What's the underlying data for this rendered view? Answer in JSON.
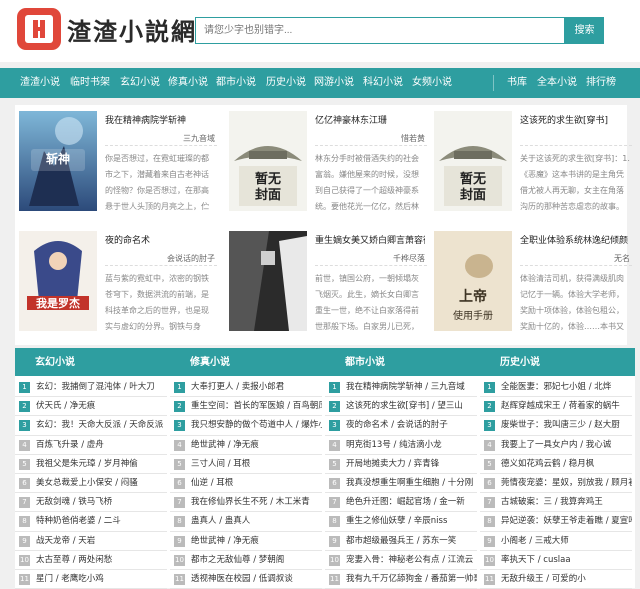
{
  "site": {
    "name": "渣渣小説網",
    "logo_letter": "H",
    "brand_color": "#e0473a",
    "accent_color": "#2e9ea0"
  },
  "search": {
    "placeholder": "请您少字也别错字...",
    "button": "搜索"
  },
  "nav": {
    "items": [
      "渣渣小说",
      "临时书架",
      "玄幻小说",
      "修真小说",
      "都市小说",
      "历史小说",
      "网游小说",
      "科幻小说",
      "女频小说"
    ],
    "right_items": [
      "书库",
      "全本小说",
      "排行榜"
    ]
  },
  "featured": [
    {
      "title": "我在精神病院学斩神",
      "author": "三九音域",
      "desc": "你是否想过，在霓虹璀璨的都市之下，潜藏着来自古老神话的怪物？你是否想过，在那高悬于世人头顶的月亮之上，伫立着守望人间的神明？你是否想过，在",
      "cover": "book1"
    },
    {
      "title": "亿亿神豪林东江珊",
      "author": "惜若黄",
      "desc": "林东分手时被借酒失约的社会富翁。嫌他屋来的时候，没想到自己获得了一个超级神豪系统。要他花光一亿亿，然后林东从此走上人生巅峰。林东：我不就了，我是",
      "cover": "placeholder"
    },
    {
      "title": "这该死的求生欲[穿书]",
      "author": "",
      "desc": "关于这该死的求生欲[穿书]：1.《恶魔》这本书讲的是主角凭借尤被人再无聊，女主在角落沟历的那种苦恋虐恋的故事。江落一穿醒来，穿成了这本书里拿一",
      "cover": "placeholder"
    },
    {
      "title": "夜的命名术",
      "author": "会说话的肘子",
      "desc": "蓝与紫的霓虹中，浓密的钢铁苍穹下，数据洪流的前端，是科技革命之后的世界，也是现实与虚幻的分界。钢铁与身体，过去与未来。这里，表世界与里世界",
      "cover": "book4"
    },
    {
      "title": "重生嫡女美又娇白卿言萧容衍",
      "author": "千桦尽落",
      "desc": "前世，镇国公府，一朝倾塌灰飞烟灭。此生，嫡长女白卿言重生一世，绝不让白家落得前世那般下场。白家男儿已死，大都城再无白家立锥之地？",
      "cover": "book5"
    },
    {
      "title": "全职业体验系统林逸纪倾颜",
      "author": "无名",
      "desc": "体验清洁司机，获得满级肌肉记忆于一辆。体验大学老师，奖励十项体验，体验包租公，奖励十亿的，体验……本书又名：《香烟宿舍》我的十个身份 …《都市未",
      "cover": "book6"
    }
  ],
  "lists": [
    {
      "title": "玄幻小说",
      "items": [
        "玄幻：我捕倒了混沌体 / 叶大刀",
        "伏天氏 / 净无痕",
        "玄幻：我！天命大反派 / 天命反派",
        "百炼飞升录 / 虚舟",
        "我祖父是朱元璋 / 岁月神偷",
        "美女总裁爱上小保安 / 闷骚",
        "无敌剑魂 / 铁马飞桥",
        "特种奶爸俏老婆 / 二斗",
        "战天龙帝 / 天岩",
        "太古至尊 / 两处闲愁",
        "星门 / 老鹰吃小鸡"
      ]
    },
    {
      "title": "修真小说",
      "items": [
        "大奉打更人 / 卖报小郎君",
        "重生空间：首长的军医娘 / 百鸟朝凤",
        "我只想安静的做个苟道中人 / 爆炸小",
        "绝世武神 / 净无痕",
        "三寸人间 / 耳根",
        "仙逆 / 耳根",
        "我在修仙界长生不死 / 木工米青",
        "蛊真人 / 蛊真人",
        "绝世武神 / 净无痕",
        "都市之无敌仙尊 / 梦朝阁",
        "透视神医在校园 / 低调叔谈"
      ]
    },
    {
      "title": "都市小说",
      "items": [
        "我在精神病院学斩神 / 三九音域",
        "这该死的求生欲[穿书] / 望三山",
        "夜的命名术 / 会说话的肘子",
        "明克街13号 / 纯洁滴小龙",
        "开局地摊卖大力 / 弈青锋",
        "我真没想重生啊重生细胞 / 十分刚",
        "绝色升迁图：崛起官场 / 金一新",
        "重生之修仙妖孽 / 辛辰niss",
        "都市超级最强兵王 / 苏东一笑",
        "宠妻入骨：神秘老公有点 / 江流云",
        "我有九千万亿舔狗金 / 番茄第一帅哥"
      ]
    },
    {
      "title": "历史小说",
      "items": [
        "全能医妻：邪妃七小姐 / 北烨",
        "赵辉穿越成宋王 / 荷着家的蜗牛",
        "废柴世子：我叫唐三少 / 赵大厨",
        "我要上了一具女户内 / 我心诚",
        "德义如花鸡云鹤 / 稳月枫",
        "莞情夜宠婆：星奴，别放我 / 顾月初孔",
        "古城破案：三 / 我算奔鸡王",
        "异妃逆袭：妖孽王爷走着瞧 / 夏宣叶",
        "小阁老 / 三戒大师",
        "率执天下 / cuslaa",
        "无敌升级王 / 可爱的小"
      ]
    }
  ]
}
